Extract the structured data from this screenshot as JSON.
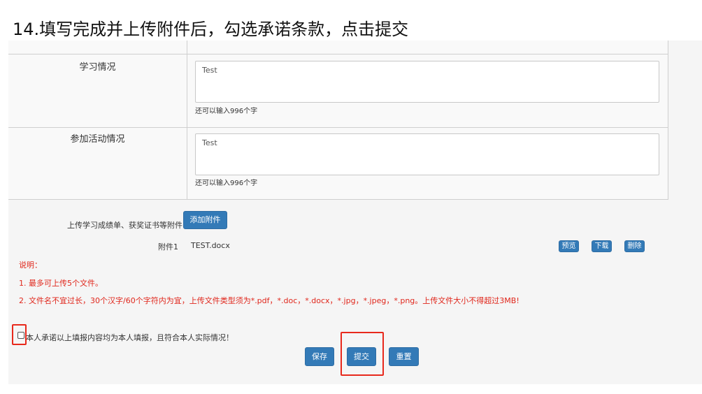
{
  "slide": {
    "title": "14.填写完成并上传附件后，勾选承诺条款，点击提交"
  },
  "form": {
    "rows": [
      {
        "label": "学习情况",
        "value": "Test",
        "remaining": "还可以输入996个字"
      },
      {
        "label": "参加活动情况",
        "value": "Test",
        "remaining": "还可以输入996个字"
      }
    ]
  },
  "upload": {
    "label": "上传学习成绩单、获奖证书等附件",
    "add_button": "添加附件",
    "attachments": [
      {
        "label": "附件1",
        "filename": "TEST.docx",
        "preview": "预览",
        "download": "下载",
        "delete": "删除"
      }
    ]
  },
  "notes": {
    "title": "说明：",
    "items": [
      "1. 最多可上传5个文件。",
      "2. 文件名不宜过长，30个汉字/60个字符内为宜，上传文件类型须为*.pdf，*.doc，*.docx，*.jpg，*.jpeg，*.png。上传文件大小不得超过3MB!"
    ]
  },
  "promise": {
    "text": "本人承诺以上填报内容均为本人填报，且符合本人实际情况！",
    "checked": false
  },
  "actions": {
    "save": "保存",
    "submit": "提交",
    "reset": "重置"
  },
  "colors": {
    "primary": "#337ab7",
    "note": "#e0261b",
    "highlight": "#e8291c"
  }
}
